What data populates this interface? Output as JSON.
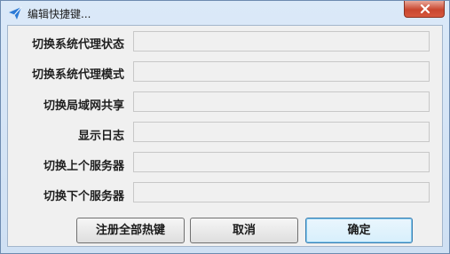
{
  "window": {
    "title": "编辑快捷键..."
  },
  "rows": [
    {
      "label": "切换系统代理状态",
      "value": ""
    },
    {
      "label": "切换系统代理模式",
      "value": ""
    },
    {
      "label": "切换局域网共享",
      "value": ""
    },
    {
      "label": "显示日志",
      "value": ""
    },
    {
      "label": "切换上个服务器",
      "value": ""
    },
    {
      "label": "切换下个服务器",
      "value": ""
    }
  ],
  "buttons": {
    "register_all": "注册全部热键",
    "cancel": "取消",
    "ok": "确定"
  },
  "colors": {
    "window_frame": "#d9e8f7",
    "close_button": "#c9472f",
    "client_bg": "#f0f0f0"
  },
  "icons": {
    "app": "paper-plane-icon",
    "close": "close-icon"
  }
}
